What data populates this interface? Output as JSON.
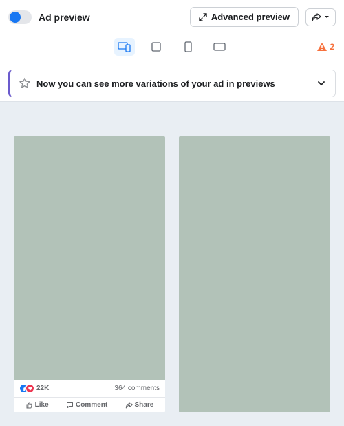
{
  "header": {
    "title": "Ad preview",
    "advanced_btn": "Advanced preview"
  },
  "warning": {
    "count": "2"
  },
  "banner": {
    "text": "Now you can see more variations of your ad in previews"
  },
  "post": {
    "reactions_count": "22K",
    "comments_label": "364 comments",
    "like_label": "Like",
    "comment_label": "Comment",
    "share_label": "Share"
  }
}
